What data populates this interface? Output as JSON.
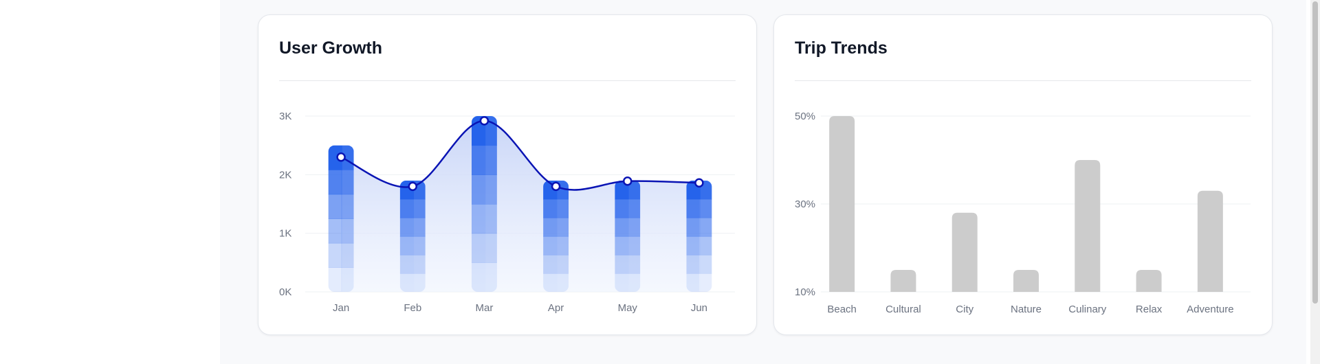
{
  "cards": {
    "left_title": "User Growth",
    "right_title": "Trip Trends"
  },
  "colors": {
    "bar_blue": "#2563eb",
    "line_navy": "#0a14b4",
    "area_fill": "#c7d4f7",
    "bar_gray": "#cccccc",
    "grid": "#eef0f3"
  },
  "chart_data": [
    {
      "type": "bar",
      "title": "User Growth",
      "xlabel": "",
      "ylabel": "",
      "categories": [
        "Jan",
        "Feb",
        "Mar",
        "Apr",
        "May",
        "Jun"
      ],
      "yticks": [
        "0K",
        "1K",
        "2K",
        "3K"
      ],
      "ylim": [
        0,
        3000
      ],
      "grid": true,
      "series": [
        {
          "type": "bar",
          "values": [
            2500,
            1900,
            3000,
            1900,
            1900,
            1900
          ]
        },
        {
          "type": "line",
          "values": [
            2300,
            1800,
            2920,
            1800,
            1890,
            1860
          ]
        }
      ]
    },
    {
      "type": "bar",
      "title": "Trip Trends",
      "xlabel": "",
      "ylabel": "",
      "categories": [
        "Beach",
        "Cultural",
        "City",
        "Nature",
        "Culinary",
        "Relax",
        "Adventure"
      ],
      "values": [
        50,
        15,
        28,
        15,
        40,
        15,
        33
      ],
      "yticks": [
        "10%",
        "30%",
        "50%"
      ],
      "ylim": [
        10,
        50
      ],
      "grid": true
    }
  ]
}
